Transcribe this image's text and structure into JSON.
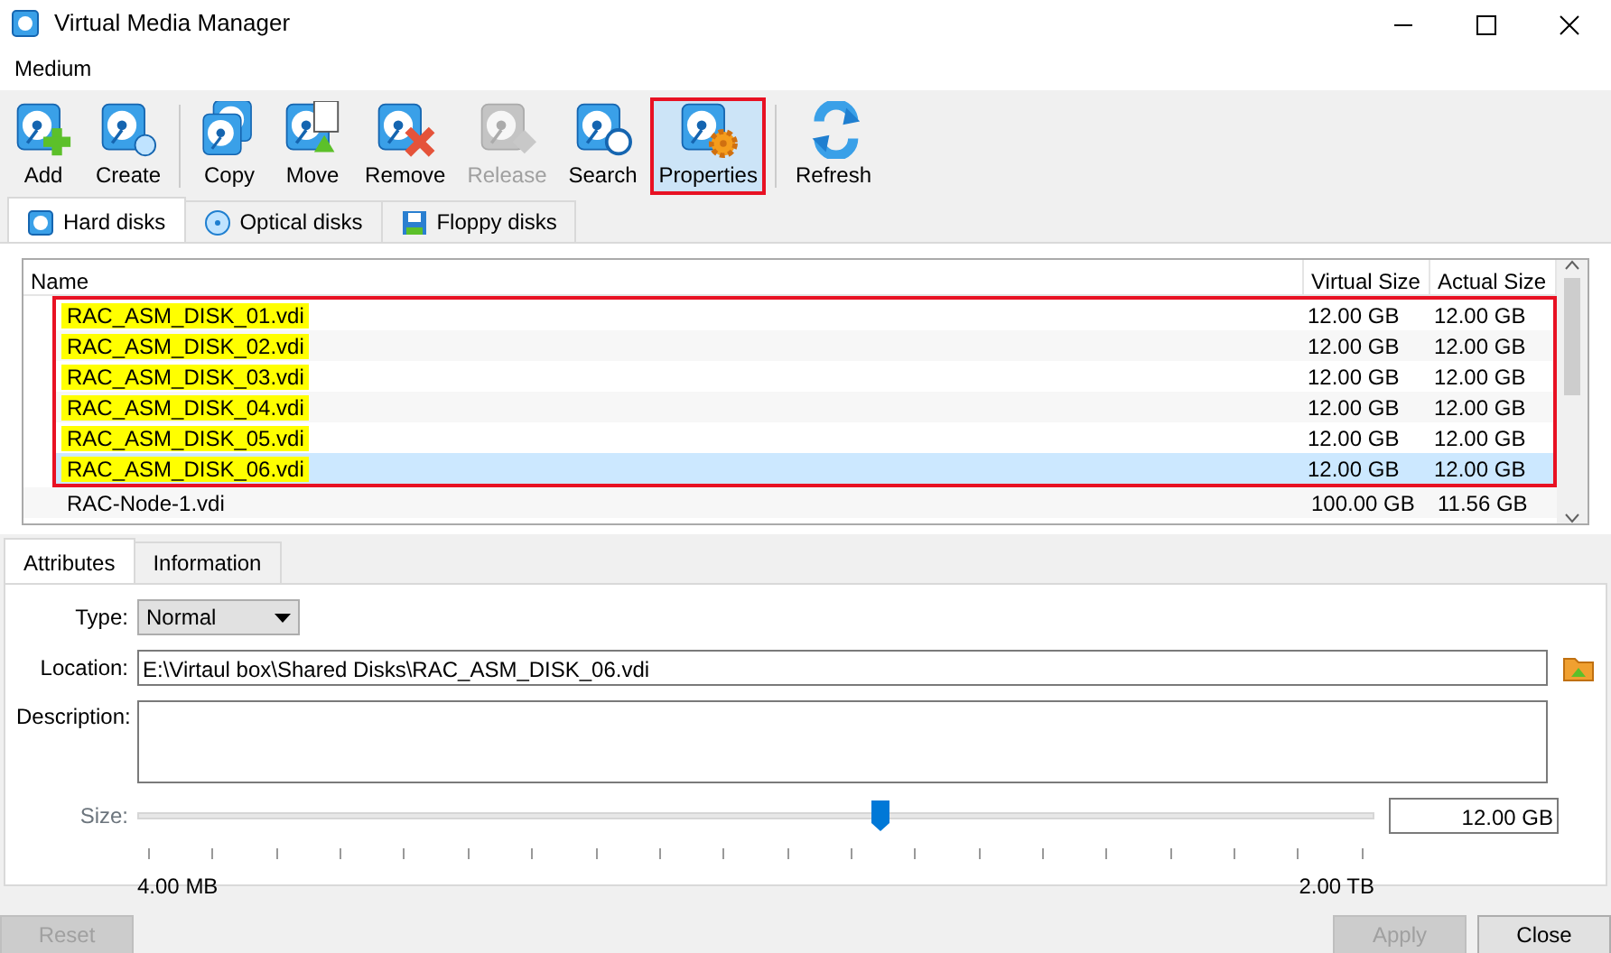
{
  "window": {
    "title": "Virtual Media Manager"
  },
  "menu": [
    "Medium"
  ],
  "toolbar": [
    {
      "label": "Add",
      "disabled": false,
      "highlighted": false
    },
    {
      "label": "Create",
      "disabled": false,
      "highlighted": false
    },
    {
      "label": "Copy",
      "disabled": false,
      "highlighted": false
    },
    {
      "label": "Move",
      "disabled": false,
      "highlighted": false
    },
    {
      "label": "Remove",
      "disabled": false,
      "highlighted": false
    },
    {
      "label": "Release",
      "disabled": true,
      "highlighted": false
    },
    {
      "label": "Search",
      "disabled": false,
      "highlighted": false
    },
    {
      "label": "Properties",
      "disabled": false,
      "highlighted": true
    },
    {
      "label": "Refresh",
      "disabled": false,
      "highlighted": false
    }
  ],
  "tabs": [
    {
      "label": "Hard disks",
      "selected": true
    },
    {
      "label": "Optical disks",
      "selected": false
    },
    {
      "label": "Floppy disks",
      "selected": false
    }
  ],
  "table": {
    "columns": [
      "Name",
      "Virtual Size",
      "Actual Size"
    ],
    "rows": [
      {
        "name": "RAC_ASM_DISK_01.vdi",
        "virtual_size": "12.00 GB",
        "actual_size": "12.00 GB",
        "selected": false,
        "highlighted": true
      },
      {
        "name": "RAC_ASM_DISK_02.vdi",
        "virtual_size": "12.00 GB",
        "actual_size": "12.00 GB",
        "selected": false,
        "highlighted": true
      },
      {
        "name": "RAC_ASM_DISK_03.vdi",
        "virtual_size": "12.00 GB",
        "actual_size": "12.00 GB",
        "selected": false,
        "highlighted": true
      },
      {
        "name": "RAC_ASM_DISK_04.vdi",
        "virtual_size": "12.00 GB",
        "actual_size": "12.00 GB",
        "selected": false,
        "highlighted": true
      },
      {
        "name": "RAC_ASM_DISK_05.vdi",
        "virtual_size": "12.00 GB",
        "actual_size": "12.00 GB",
        "selected": false,
        "highlighted": true
      },
      {
        "name": "RAC_ASM_DISK_06.vdi",
        "virtual_size": "12.00 GB",
        "actual_size": "12.00 GB",
        "selected": true,
        "highlighted": true
      },
      {
        "name": "RAC-Node-1.vdi",
        "virtual_size": "100.00 GB",
        "actual_size": "11.56 GB",
        "selected": false,
        "highlighted": false
      }
    ]
  },
  "detail_tabs": [
    {
      "label": "Attributes",
      "selected": true
    },
    {
      "label": "Information",
      "selected": false
    }
  ],
  "attributes": {
    "type_label": "Type:",
    "type_value": "Normal",
    "location_label": "Location:",
    "location_value": "E:\\Virtaul box\\Shared Disks\\RAC_ASM_DISK_06.vdi",
    "description_label": "Description:",
    "size_label": "Size:",
    "size": {
      "level": 0.6,
      "value": "12.00 GB",
      "min_label": "4.00 MB",
      "max_label": "2.00 TB"
    }
  },
  "buttons": [
    {
      "label": "Reset",
      "disabled": true
    },
    {
      "label": "Apply",
      "disabled": true
    },
    {
      "label": "Close",
      "disabled": false
    }
  ]
}
